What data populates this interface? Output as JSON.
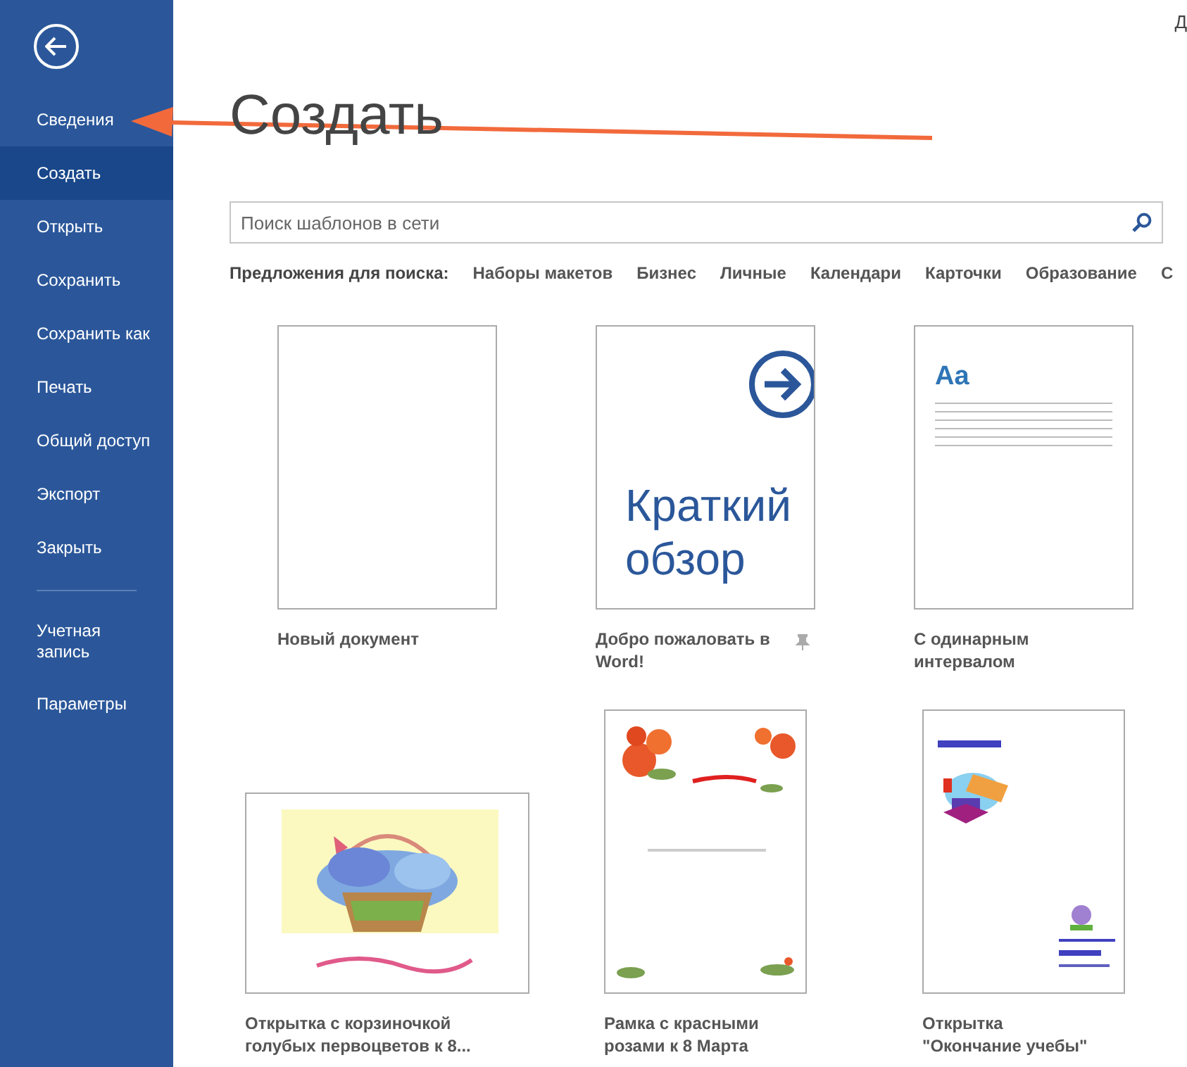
{
  "account": {
    "name": "Д"
  },
  "sidebar": {
    "items": [
      {
        "label": "Сведения",
        "selected": false
      },
      {
        "label": "Создать",
        "selected": true
      },
      {
        "label": "Открыть",
        "selected": false
      },
      {
        "label": "Сохранить",
        "selected": false
      },
      {
        "label": "Сохранить как",
        "selected": false
      },
      {
        "label": "Печать",
        "selected": false
      },
      {
        "label": "Общий доступ",
        "selected": false
      },
      {
        "label": "Экспорт",
        "selected": false
      },
      {
        "label": "Закрыть",
        "selected": false
      }
    ],
    "bottom_items": [
      {
        "label": "Учетная запись",
        "selected": false
      },
      {
        "label": "Параметры",
        "selected": false
      }
    ]
  },
  "title": "Создать",
  "search": {
    "placeholder": "Поиск шаблонов в сети"
  },
  "suggestions": {
    "label": "Предложения для поиска:",
    "items": [
      "Наборы макетов",
      "Бизнес",
      "Личные",
      "Календари",
      "Карточки",
      "Образование",
      "С"
    ]
  },
  "templates": [
    {
      "kind": "blank",
      "title": "Новый документ",
      "pinned": false
    },
    {
      "kind": "tour",
      "title": "Добро пожаловать в Word!",
      "preview_text": "Краткий обзор",
      "pinned": true
    },
    {
      "kind": "single",
      "title": "С одинарным интервалом",
      "preview_text": "Aa",
      "pinned": false
    },
    {
      "kind": "basket",
      "title": "Открытка с корзиночкой голубых первоцветов к 8...",
      "pinned": false
    },
    {
      "kind": "roses",
      "title": "Рамка с красными розами к 8 Марта",
      "pinned": false
    },
    {
      "kind": "graduation",
      "title": "Открытка \"Окончание учебы\"",
      "pinned": false
    }
  ],
  "annotation": {
    "kind": "arrow"
  }
}
